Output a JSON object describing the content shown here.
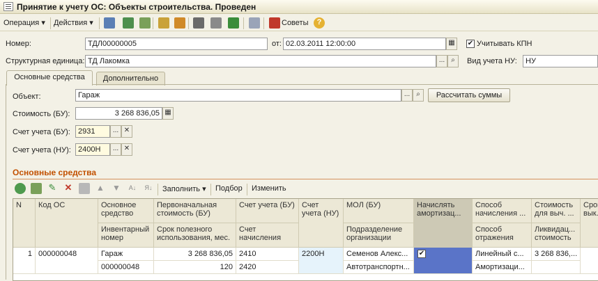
{
  "window": {
    "title": "Принятие к учету ОС: Объекты строительства. Проведен"
  },
  "toolbar": {
    "operation": "Операция",
    "actions": "Действия",
    "tips": "Советы"
  },
  "header": {
    "number_label": "Номер:",
    "number_value": "ТДЛ00000005",
    "date_label": "от:",
    "date_value": "02.03.2011 12:00:00",
    "kpn_label": "Учитывать КПН",
    "kpn_checked": true,
    "unit_label": "Структурная единица:",
    "unit_value": "ТД Лакомка",
    "nu_label": "Вид учета НУ:",
    "nu_value": "НУ"
  },
  "tabs": [
    "Основные средства",
    "Дополнительно"
  ],
  "form": {
    "object_label": "Объект:",
    "object_value": "Гараж",
    "calc_button": "Рассчитать суммы",
    "cost_label": "Стоимость (БУ):",
    "cost_value": "3 268 836,05",
    "acc_bu_label": "Счет учета (БУ):",
    "acc_bu_value": "2931",
    "acc_nu_label": "Счет учета (НУ):",
    "acc_nu_value": "2400Н"
  },
  "section": {
    "title": "Основные средства",
    "fill": "Заполнить",
    "pick": "Подбор",
    "change": "Изменить"
  },
  "grid": {
    "headers": {
      "n": "N",
      "code": "Код ОС",
      "asset_a": "Основное средство",
      "asset_b": "Инвентарный номер",
      "cost_a": "Первоначальная стоимость (БУ)",
      "cost_b": "Срок полезного использования, мес.",
      "acc_a": "Счет учета (БУ)",
      "acc_b": "Счет начисления",
      "accnu": "Счет учета (НУ)",
      "mol_a": "МОЛ (БУ)",
      "mol_b": "Подразделение организации",
      "amort": "Начислять амортизац...",
      "method_a": "Способ начисления ...",
      "method_b": "Способ отражения",
      "liq_a": "Стоимость для выч. ...",
      "liq_b": "Ликвидац... стоимость",
      "last": "Срок вык..."
    },
    "row": {
      "n": "1",
      "code": "000000048",
      "asset": "Гараж",
      "inv": "000000048",
      "cost": "3 268 836,05",
      "life": "120",
      "acc": "2410",
      "acc2": "2420",
      "accnu": "2200Н",
      "mol": "Семенов Алекс...",
      "dept": "Автотранспортн...",
      "method": "Линейный с...",
      "refl": "Амортизаци...",
      "liq": "3 268 836,...",
      "amort_checked": true
    }
  }
}
